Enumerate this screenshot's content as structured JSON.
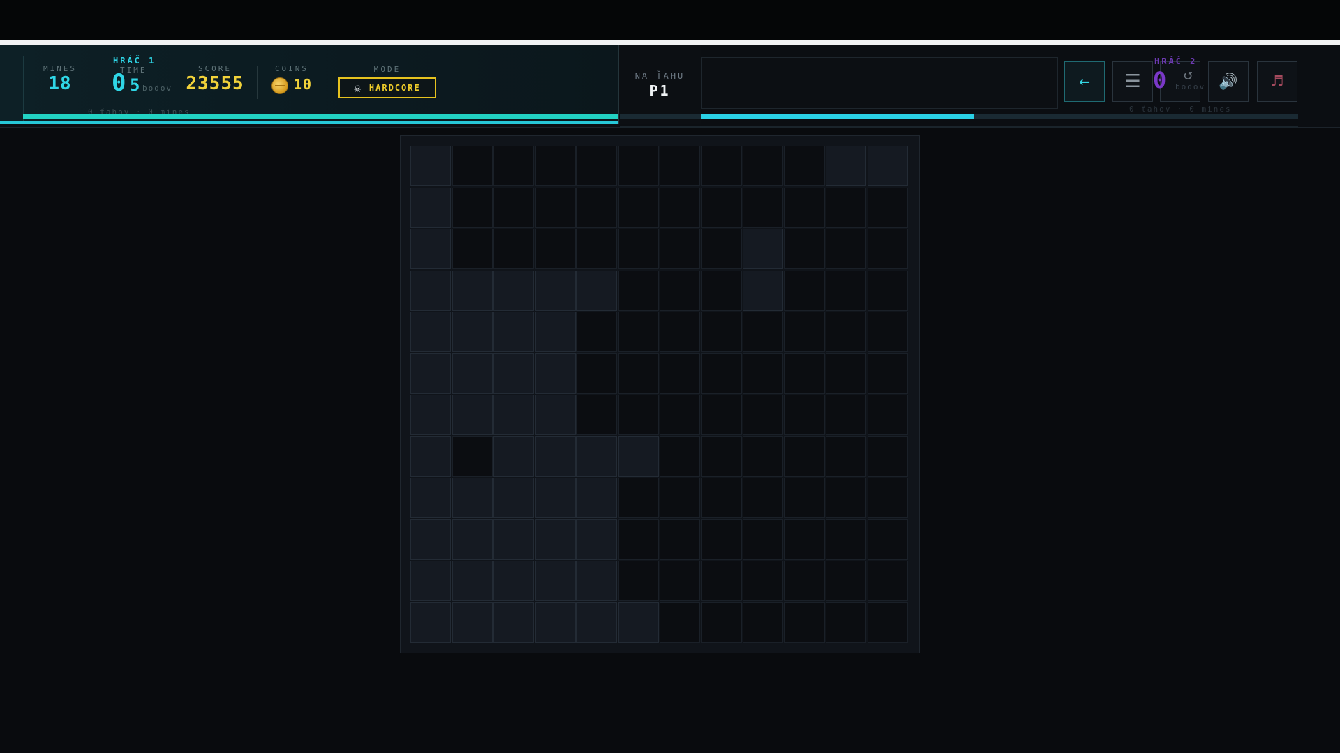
{
  "hud": {
    "player1": {
      "name": "HRÁČ 1",
      "points": "0",
      "points_unit": "bodov",
      "sub": "0 ťahov · 0 mines"
    },
    "mines": {
      "label": "MINES",
      "value": "18"
    },
    "time": {
      "label": "TIME",
      "value": "5"
    },
    "score": {
      "label": "SCORE",
      "value": "23555"
    },
    "coins": {
      "label": "COINS",
      "value": "10",
      "icon": "coin-icon"
    },
    "mode": {
      "label": "MODE",
      "value": "HARDCORE",
      "icon": "skull-icon"
    },
    "turn": {
      "label": "NA ŤAHU",
      "value": "P1"
    },
    "player2": {
      "name": "HRÁČ 2",
      "points": "0",
      "points_unit": "bodov",
      "sub": "0 ťahov · 0 mines"
    },
    "progress": 0.4
  },
  "controls": {
    "back_icon": "←",
    "menu_icon": "☰",
    "undo_icon": "↺",
    "sound_icon": "🔊",
    "music_icon": "♬"
  },
  "board": {
    "rows": 12,
    "cols": 12,
    "cells": [
      "RHHHHHHHHHRR",
      "RHHHHHHHHHHH",
      "RHHHHHHHRHHH",
      "RRRRRHHHRHHH",
      "RRRRHHHHHHHH",
      "RRRRHHHHHHHH",
      "RRRRHHHHHHHH",
      "RHRRRRHHHHHH",
      "RRRRRHHHHHHH",
      "RRRRRHHHHHHH",
      "RRRRRHHHHHHH",
      "RRRRRRHHHHHH"
    ]
  }
}
